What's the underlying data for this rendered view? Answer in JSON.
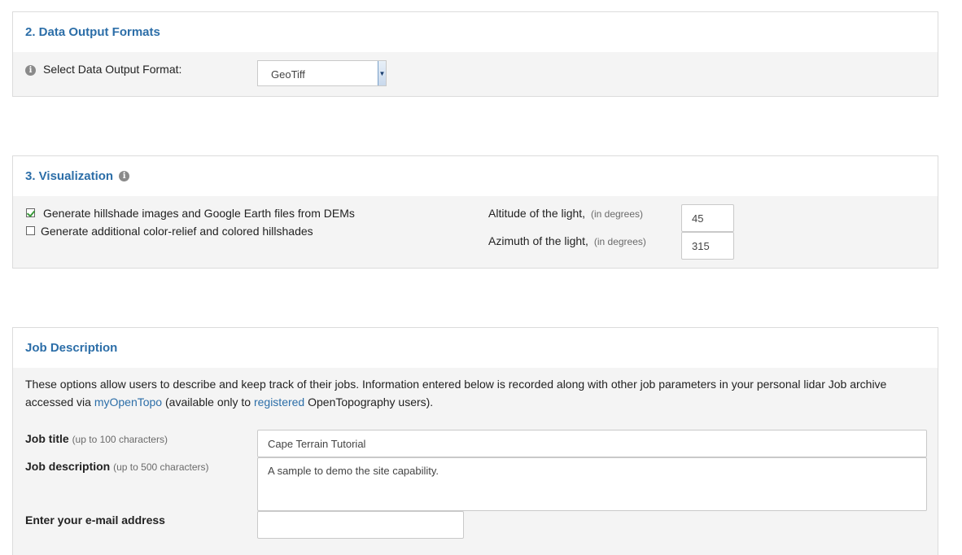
{
  "output_formats": {
    "title": "2. Data Output Formats",
    "select_label": "Select Data Output Format:",
    "selected_format": "GeoTiff"
  },
  "visualization": {
    "title": "3. Visualization",
    "option_hillshade": "Generate hillshade images and Google Earth files from DEMs",
    "option_hillshade_checked": true,
    "option_color_relief": "Generate additional color-relief and colored hillshades",
    "option_color_relief_checked": false,
    "altitude_label": "Altitude of the light,",
    "altitude_unit": "(in degrees)",
    "altitude_value": "45",
    "azimuth_label": "Azimuth of the light,",
    "azimuth_unit": "(in degrees)",
    "azimuth_value": "315"
  },
  "job_description": {
    "title": "Job Description",
    "intro_part1": "These options allow users to describe and keep track of their jobs. Information entered below is recorded along with other job parameters in your personal lidar Job archive accessed via ",
    "intro_link1": "myOpenTopo",
    "intro_part2": " (available only to ",
    "intro_link2": "registered",
    "intro_part3": " OpenTopography users).",
    "job_title_label": "Job title",
    "job_title_hint": "(up to 100 characters)",
    "job_title_value": "Cape Terrain Tutorial",
    "job_desc_label": "Job description",
    "job_desc_hint": "(up to 500 characters)",
    "job_desc_value": "A sample to demo the site capability.",
    "email_label": "Enter your e-mail address",
    "email_value": ""
  },
  "colors": {
    "heading": "#2c6ea8",
    "panel_body": "#f4f4f4",
    "border": "#dcdcdc"
  }
}
